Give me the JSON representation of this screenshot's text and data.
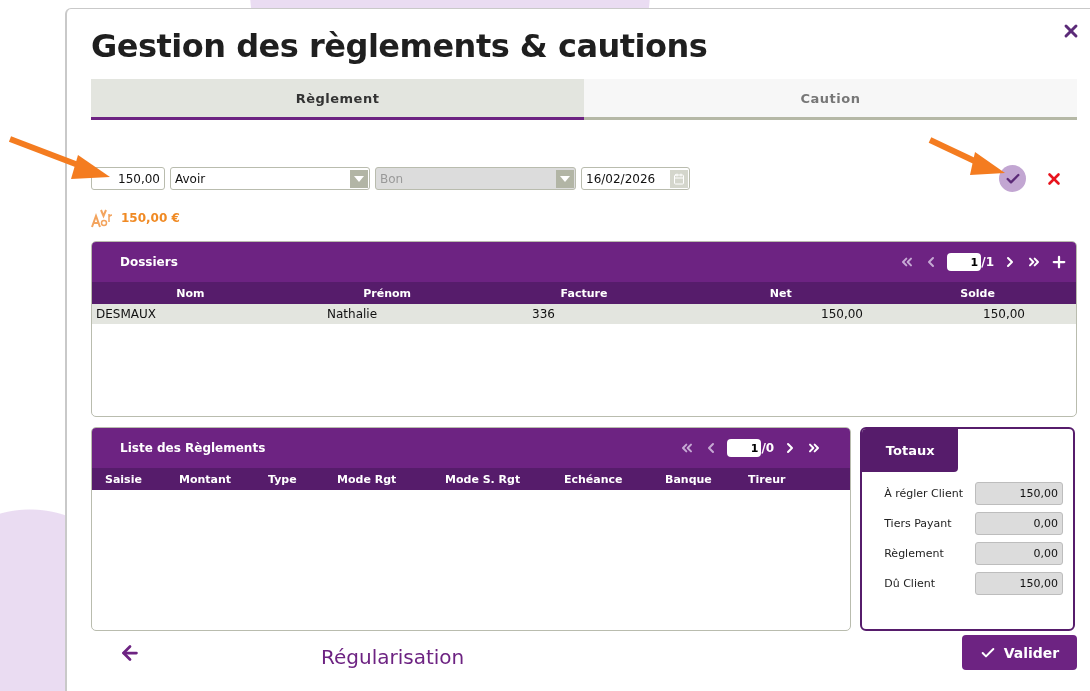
{
  "window": {
    "title": "Gestion des règlements & cautions"
  },
  "tabs": [
    {
      "label": "Règlement",
      "selected": true
    },
    {
      "label": "Caution",
      "selected": false
    }
  ],
  "payment_form": {
    "amount": "150,00",
    "type": {
      "value": "Avoir",
      "disabled": false
    },
    "mode": {
      "value": "Bon",
      "disabled": true
    },
    "date": "16/02/2026"
  },
  "credit_note": {
    "amount": "150,00 €"
  },
  "dossiers": {
    "title": "Dossiers",
    "pager": {
      "page": "1",
      "total": "/1"
    },
    "columns": [
      "Nom",
      "Prénom",
      "Facture",
      "Net",
      "Solde"
    ],
    "rows": [
      {
        "cells": [
          "DESMAUX",
          "Nathalie",
          "336",
          "150,00",
          "150,00"
        ],
        "selected": true
      }
    ]
  },
  "reglements": {
    "title": "Liste des Règlements",
    "pager": {
      "page": "1",
      "total": "/0"
    },
    "columns": [
      "Saisie",
      "Montant",
      "Type",
      "Mode Rgt",
      "Mode S. Rgt",
      "Echéance",
      "Banque",
      "Tireur"
    ]
  },
  "totals": {
    "title": "Totaux",
    "rows": [
      {
        "label": "À régler Client",
        "value": "150,00"
      },
      {
        "label": "Tiers Payant",
        "value": "0,00"
      },
      {
        "label": "Règlement",
        "value": "0,00"
      },
      {
        "label": "Dû Client",
        "value": "150,00"
      }
    ]
  },
  "footer": {
    "link": "Régularisation",
    "validate": "Valider"
  }
}
